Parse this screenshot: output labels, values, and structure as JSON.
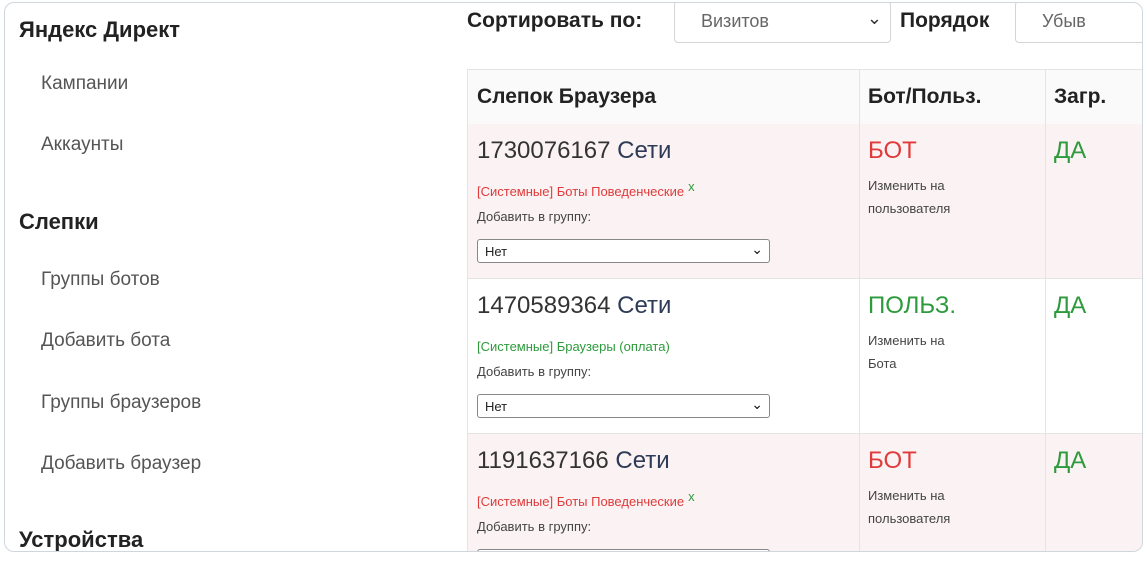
{
  "sidebar": {
    "sections": [
      {
        "title": "Яндекс Директ",
        "items": [
          "Кампании",
          "Аккаунты"
        ]
      },
      {
        "title": "Слепки",
        "items": [
          "Группы ботов",
          "Добавить бота",
          "Группы браузеров",
          "Добавить браузер"
        ]
      },
      {
        "title": "Устройства",
        "items": []
      }
    ]
  },
  "toolbar": {
    "sort_label": "Сортировать по:",
    "sort_value": "Визитов",
    "order_label": "Порядок",
    "order_value": "Убыв"
  },
  "table": {
    "headers": [
      "Слепок Браузера",
      "Бот/Польз.",
      "Загр."
    ],
    "add_group_label": "Добавить в группу:",
    "rows": [
      {
        "id": "1730076167",
        "net": "Сети",
        "tag": "[Системные] Боты Поведенческие",
        "tag_remove": "x",
        "group": "Нет",
        "status": "БОТ",
        "change_1": "Изменить на",
        "change_2": "пользователя",
        "loaded": "ДА"
      },
      {
        "id": "1470589364",
        "net": "Сети",
        "tag": "[Системные] Браузеры (оплата)",
        "tag_remove": "",
        "group": "Нет",
        "status": "ПОЛЬЗ.",
        "change_1": "Изменить на",
        "change_2": "Бота",
        "loaded": "ДА"
      },
      {
        "id": "1191637166",
        "net": "Сети",
        "tag": "[Системные] Боты Поведенческие",
        "tag_remove": "x",
        "group": "",
        "status": "БОТ",
        "change_1": "Изменить на",
        "change_2": "пользователя",
        "loaded": "ДА"
      }
    ]
  },
  "colors": {
    "bot": "#e03a3a",
    "user": "#2d9a3c",
    "row_pink": "#fbf3f3"
  },
  "icons": {
    "select_chevron": "chevron-down-icon"
  }
}
